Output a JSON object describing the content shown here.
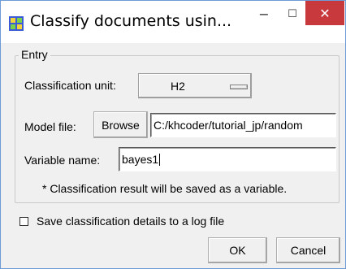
{
  "window": {
    "title": "Classify documents usin...",
    "minimize_glyph": "−",
    "maximize_glyph": "☐",
    "close_glyph": "✕",
    "accent_color": "#c8393d"
  },
  "entry_group": {
    "legend": "Entry",
    "classification_unit": {
      "label": "Classification unit:",
      "selected": "H2"
    },
    "model_file": {
      "label": "Model file:",
      "browse_label": "Browse",
      "value": "C:/khcoder/tutorial_jp/random"
    },
    "variable_name": {
      "label": "Variable name:",
      "value": "bayes1"
    },
    "note": "* Classification result will be saved as a variable."
  },
  "log_option": {
    "label": "Save classification details to a log file",
    "checked": false
  },
  "buttons": {
    "ok": "OK",
    "cancel": "Cancel"
  }
}
